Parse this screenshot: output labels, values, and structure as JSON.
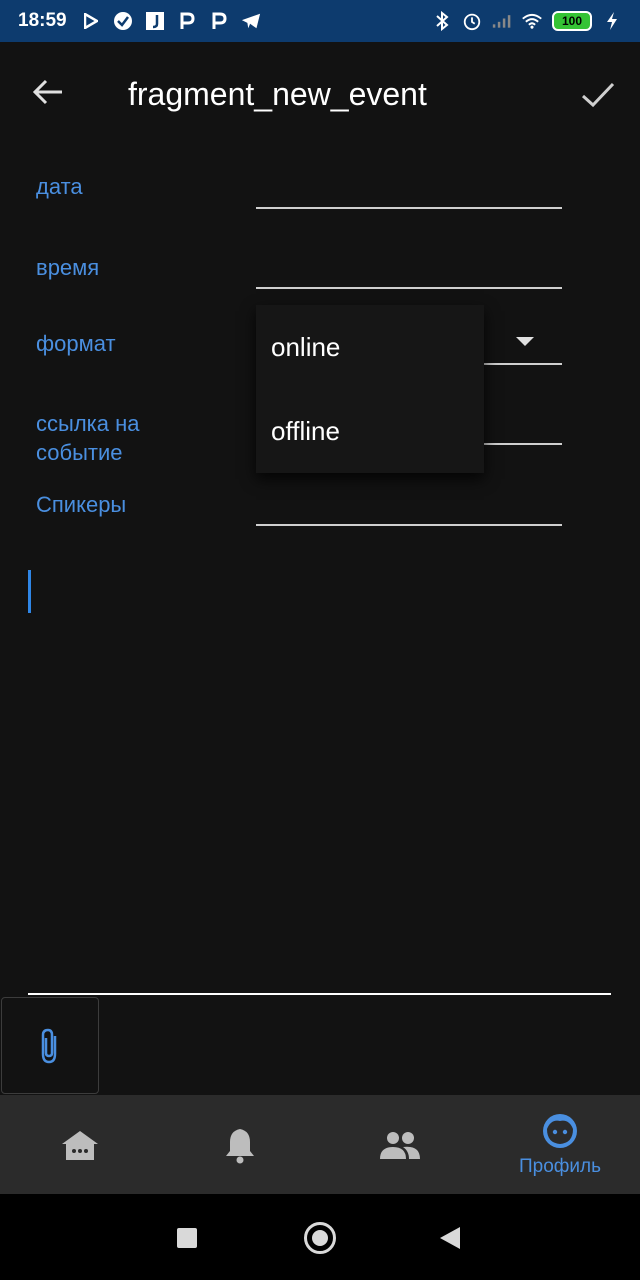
{
  "status_bar": {
    "time": "18:59",
    "battery": "100",
    "left_icons": [
      "play-store-icon",
      "check-circle-icon",
      "j-app-icon",
      "p-app-icon",
      "p-app-icon",
      "telegram-icon"
    ],
    "right_icons": [
      "bluetooth-icon",
      "alarm-icon",
      "signal-icon",
      "wifi-icon",
      "battery-icon",
      "charging-icon"
    ]
  },
  "toolbar": {
    "title": "fragment_new_event",
    "back_icon": "arrow-back-icon",
    "confirm_icon": "check-icon"
  },
  "form": {
    "date_label": "дата",
    "time_label": "время",
    "format_label": "формат",
    "link_label_line1": "ссылка на",
    "link_label_line2": "событие",
    "speakers_label": "Спикеры"
  },
  "format_dropdown": {
    "options": [
      "online",
      "offline"
    ]
  },
  "attach": {
    "icon": "paperclip-icon"
  },
  "bottom_nav": {
    "items": [
      {
        "icon": "home-icon",
        "label": ""
      },
      {
        "icon": "bell-icon",
        "label": ""
      },
      {
        "icon": "people-icon",
        "label": ""
      },
      {
        "icon": "face-icon",
        "label": "Профиль"
      }
    ],
    "active_color": "#4a8fe0",
    "inactive_color": "#bdbdbd"
  },
  "colors": {
    "accent": "#4a8fe0",
    "status_bar": "#0d3b6e",
    "background": "#121212"
  }
}
